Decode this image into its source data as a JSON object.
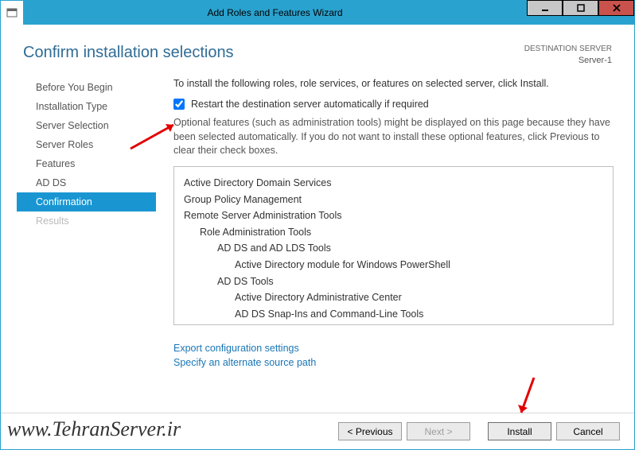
{
  "window": {
    "title": "Add Roles and Features Wizard"
  },
  "header": {
    "page_title": "Confirm installation selections",
    "dest_label": "DESTINATION SERVER",
    "dest_server": "Server-1"
  },
  "nav": {
    "items": [
      {
        "label": "Before You Begin",
        "state": "normal"
      },
      {
        "label": "Installation Type",
        "state": "normal"
      },
      {
        "label": "Server Selection",
        "state": "normal"
      },
      {
        "label": "Server Roles",
        "state": "normal"
      },
      {
        "label": "Features",
        "state": "normal"
      },
      {
        "label": "AD DS",
        "state": "normal"
      },
      {
        "label": "Confirmation",
        "state": "selected"
      },
      {
        "label": "Results",
        "state": "disabled"
      }
    ]
  },
  "main": {
    "intro": "To install the following roles, role services, or features on selected server, click Install.",
    "restart_label": "Restart the destination server automatically if required",
    "restart_checked": true,
    "note": "Optional features (such as administration tools) might be displayed on this page because they have been selected automatically. If you do not want to install these optional features, click Previous to clear their check boxes.",
    "features": [
      {
        "level": 0,
        "label": "Active Directory Domain Services"
      },
      {
        "level": 0,
        "label": "Group Policy Management"
      },
      {
        "level": 0,
        "label": "Remote Server Administration Tools"
      },
      {
        "level": 1,
        "label": "Role Administration Tools"
      },
      {
        "level": 2,
        "label": "AD DS and AD LDS Tools"
      },
      {
        "level": 3,
        "label": "Active Directory module for Windows PowerShell"
      },
      {
        "level": 2,
        "label": "AD DS Tools"
      },
      {
        "level": 3,
        "label": "Active Directory Administrative Center"
      },
      {
        "level": 3,
        "label": "AD DS Snap-Ins and Command-Line Tools"
      }
    ],
    "link_export": "Export configuration settings",
    "link_source": "Specify an alternate source path"
  },
  "footer": {
    "prev": "< Previous",
    "next": "Next >",
    "install": "Install",
    "cancel": "Cancel"
  },
  "watermark": "www.TehranServer.ir"
}
